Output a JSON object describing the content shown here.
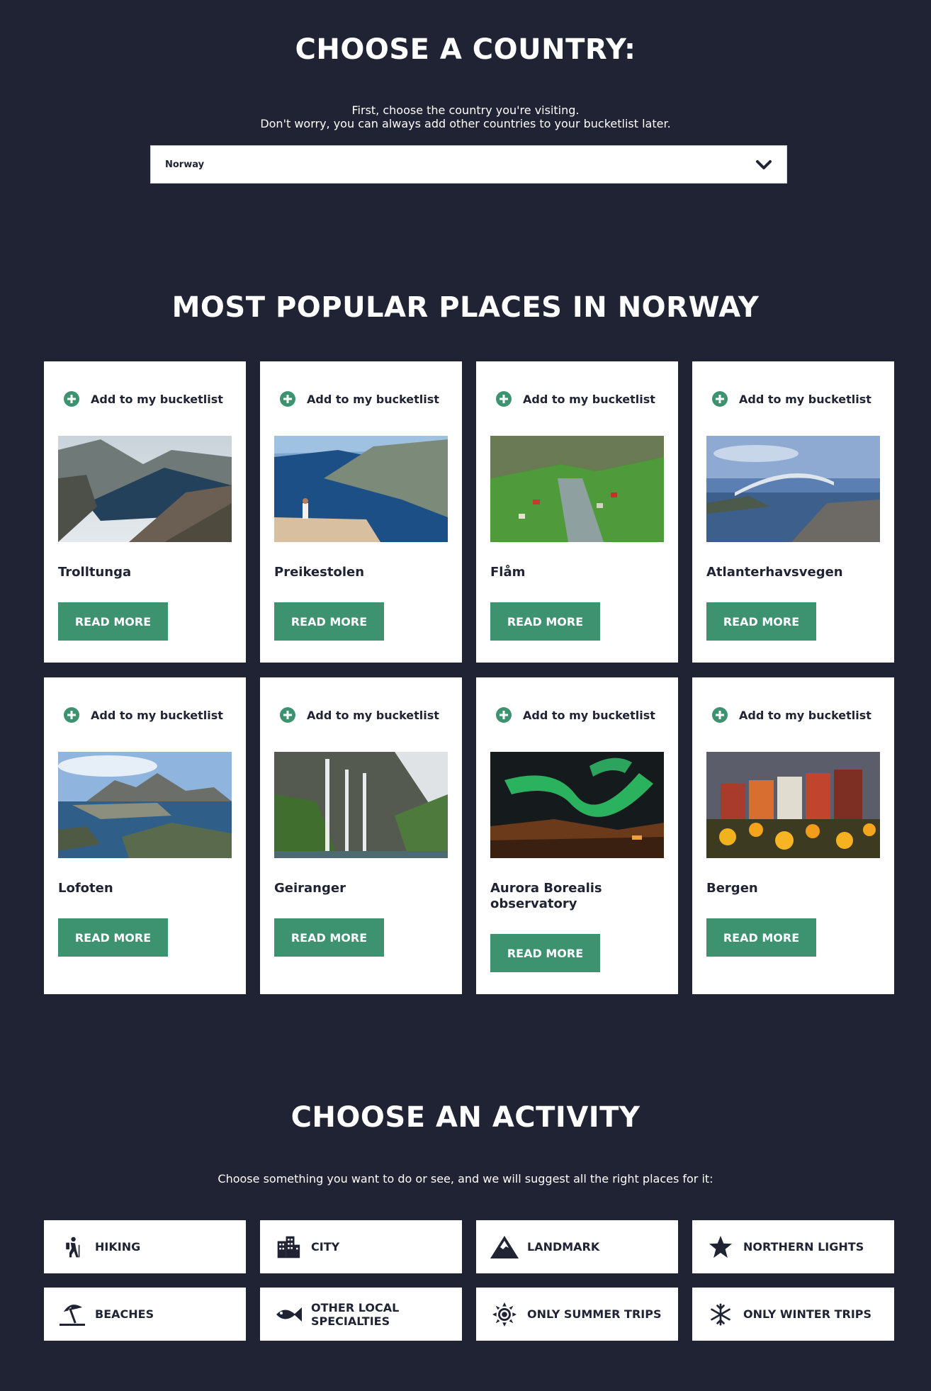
{
  "country_section": {
    "heading": "CHOOSE A COUNTRY:",
    "intro_line1": "First, choose the country you're visiting.",
    "intro_line2": "Don't worry, you can always add other countries to your bucketlist later.",
    "select_value": "Norway"
  },
  "places_section": {
    "heading": "MOST POPULAR PLACES IN NORWAY",
    "bucketlist_label": "Add to my bucketlist",
    "read_more_label": "READ MORE",
    "places": [
      {
        "name": "Trolltunga",
        "image": "fjord-cliff-photo"
      },
      {
        "name": "Preikestolen",
        "image": "pulpit-rock-photo"
      },
      {
        "name": "Flåm",
        "image": "valley-village-photo"
      },
      {
        "name": "Atlanterhavsvegen",
        "image": "ocean-bridge-photo"
      },
      {
        "name": "Lofoten",
        "image": "island-village-photo"
      },
      {
        "name": "Geiranger",
        "image": "waterfall-photo"
      },
      {
        "name": "Aurora Borealis observatory",
        "image": "northern-lights-photo"
      },
      {
        "name": "Bergen",
        "image": "flowers-houses-photo"
      }
    ]
  },
  "activity_section": {
    "heading": "CHOOSE AN ACTIVITY",
    "intro": "Choose something you want to do or see, and we will suggest all the right places for it:",
    "activities": [
      {
        "label": "HIKING",
        "icon": "hiker-icon"
      },
      {
        "label": "CITY",
        "icon": "city-icon"
      },
      {
        "label": "LANDMARK",
        "icon": "mountain-icon"
      },
      {
        "label": "NORTHERN LIGHTS",
        "icon": "star-icon"
      },
      {
        "label": "BEACHES",
        "icon": "umbrella-beach-icon"
      },
      {
        "label": "OTHER LOCAL SPECIALTIES",
        "icon": "fish-icon"
      },
      {
        "label": "ONLY SUMMER TRIPS",
        "icon": "sun-icon"
      },
      {
        "label": "ONLY WINTER TRIPS",
        "icon": "snowflake-icon"
      }
    ]
  },
  "colors": {
    "background": "#1f2333",
    "accent": "#3d9270",
    "card": "#ffffff",
    "text_dark": "#1f2333"
  }
}
